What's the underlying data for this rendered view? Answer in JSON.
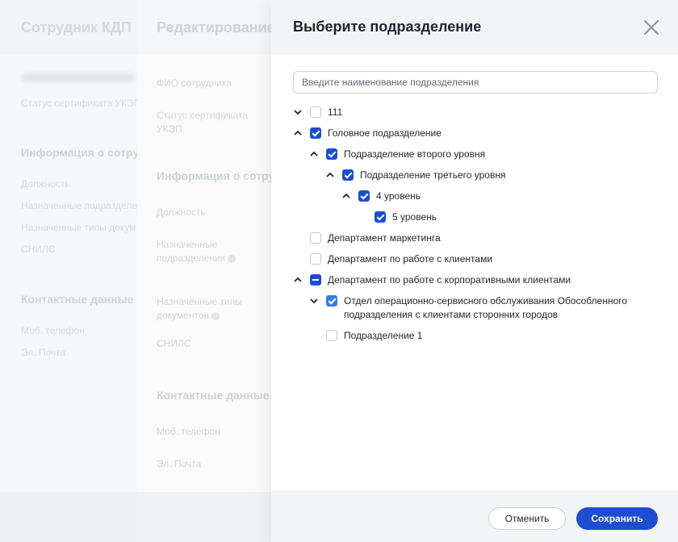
{
  "background_card": {
    "title": "Сотрудник КДП",
    "cert_status": "Статус сертификата УКЭП",
    "section_info": "Информация о сотрудн",
    "position": "Должность",
    "assigned_units": "Назначенные подразделе",
    "assigned_doc_types": "Назначенные типы докум",
    "snils": "СНИЛС",
    "section_contacts": "Контактные данные",
    "mobile": "Моб. телефон",
    "email": "Эл. Почта"
  },
  "background_edit": {
    "title": "Редактирование",
    "fio": "ФИО сотрудника",
    "cert_status": "Статус сертификата УКЭП",
    "section_info": "Информация о сотруд",
    "position": "Должность",
    "assigned_units": "Назначенные подразделения",
    "assigned_doc_types": "Назначенные типы документов",
    "snils": "СНИЛС",
    "section_contacts": "Контактные данные",
    "mobile": "Моб. телефон",
    "email": "Эл. Почта"
  },
  "modal": {
    "title": "Выберите подразделение",
    "search_placeholder": "Введите наименование подразделения",
    "tree": [
      {
        "label": "111",
        "state": "unchecked",
        "chevron": "collapsed"
      },
      {
        "label": "Головное подразделение",
        "state": "checked",
        "chevron": "expanded"
      },
      {
        "label": "Подразделение второго уровня",
        "state": "checked",
        "chevron": "expanded"
      },
      {
        "label": "Подразделение третьего уровня",
        "state": "checked",
        "chevron": "expanded"
      },
      {
        "label": "4 уровень",
        "state": "checked",
        "chevron": "expanded"
      },
      {
        "label": "5 уровень",
        "state": "checked",
        "chevron": "none"
      },
      {
        "label": "Департамент маркетинга",
        "state": "unchecked",
        "chevron": "none"
      },
      {
        "label": "Департамент по работе с клиентами",
        "state": "unchecked",
        "chevron": "none"
      },
      {
        "label": "Департамент по работе с корпоративными клиентами",
        "state": "indeterminate",
        "chevron": "expanded"
      },
      {
        "label": "Отдел операционно-сервисного обслуживания Обособленного подразделения с клиентами сторонних городов",
        "state": "checked",
        "chevron": "collapsed"
      },
      {
        "label": "Подразделение 1",
        "state": "unchecked",
        "chevron": "none"
      }
    ],
    "cancel_label": "Отменить",
    "save_label": "Сохранить"
  },
  "colors": {
    "accent": "#1d4ed1",
    "header_bg": "#f3f4f6",
    "text": "#1f2329"
  }
}
